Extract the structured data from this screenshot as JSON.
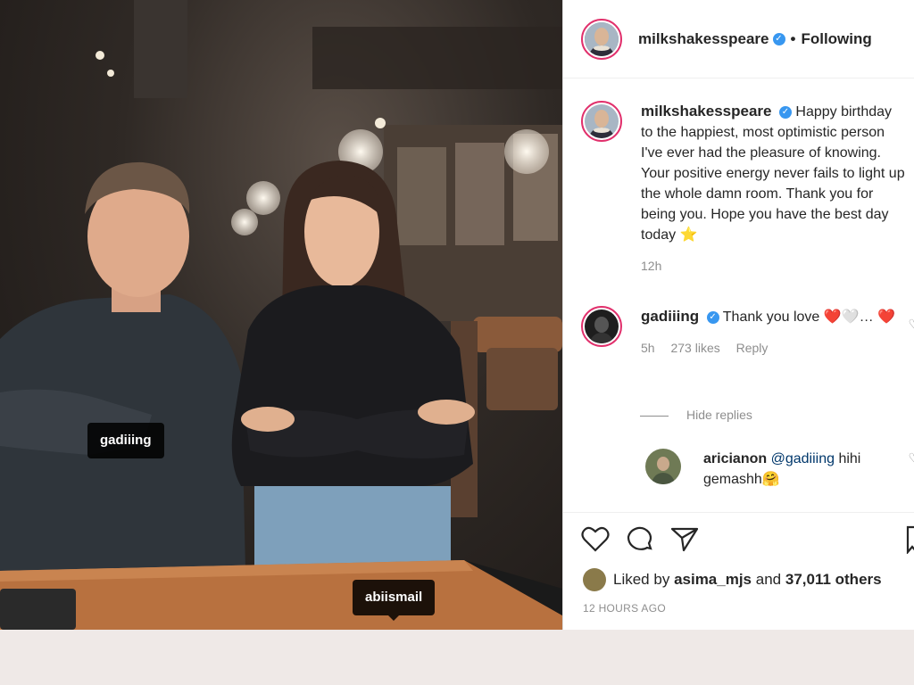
{
  "photo": {
    "tags": [
      "gadiiing",
      "abiismail"
    ]
  },
  "header": {
    "username": "milkshakesspeare",
    "separator": "•",
    "follow_status": "Following"
  },
  "caption": {
    "username": "milkshakesspeare",
    "text": "Happy birthday to the happiest, most optimistic person I've ever had the pleasure of knowing. Your positive energy never fails to light up the whole damn room. Thank you for being you. Hope you have the best day today ⭐",
    "time": "12h"
  },
  "comments": [
    {
      "username": "gadiiing",
      "text": "Thank you love ❤️🤍… ❤️",
      "time": "5h",
      "likes": "273 likes",
      "reply_label": "Reply"
    }
  ],
  "hide_replies_label": "Hide replies",
  "replies": [
    {
      "username": "aricianon",
      "mention": "@gadiiing",
      "text": " hihi gemashh🤗"
    }
  ],
  "likes": {
    "prefix": "Liked by ",
    "user": "asima_mjs",
    "middle": " and ",
    "others": "37,011 others"
  },
  "timestamp": "12 HOURS AGO",
  "colors": {
    "verified": "#3897f0",
    "story_ring": "#e1306c",
    "mention": "#00376b",
    "meta_gray": "#8e8e8e"
  }
}
